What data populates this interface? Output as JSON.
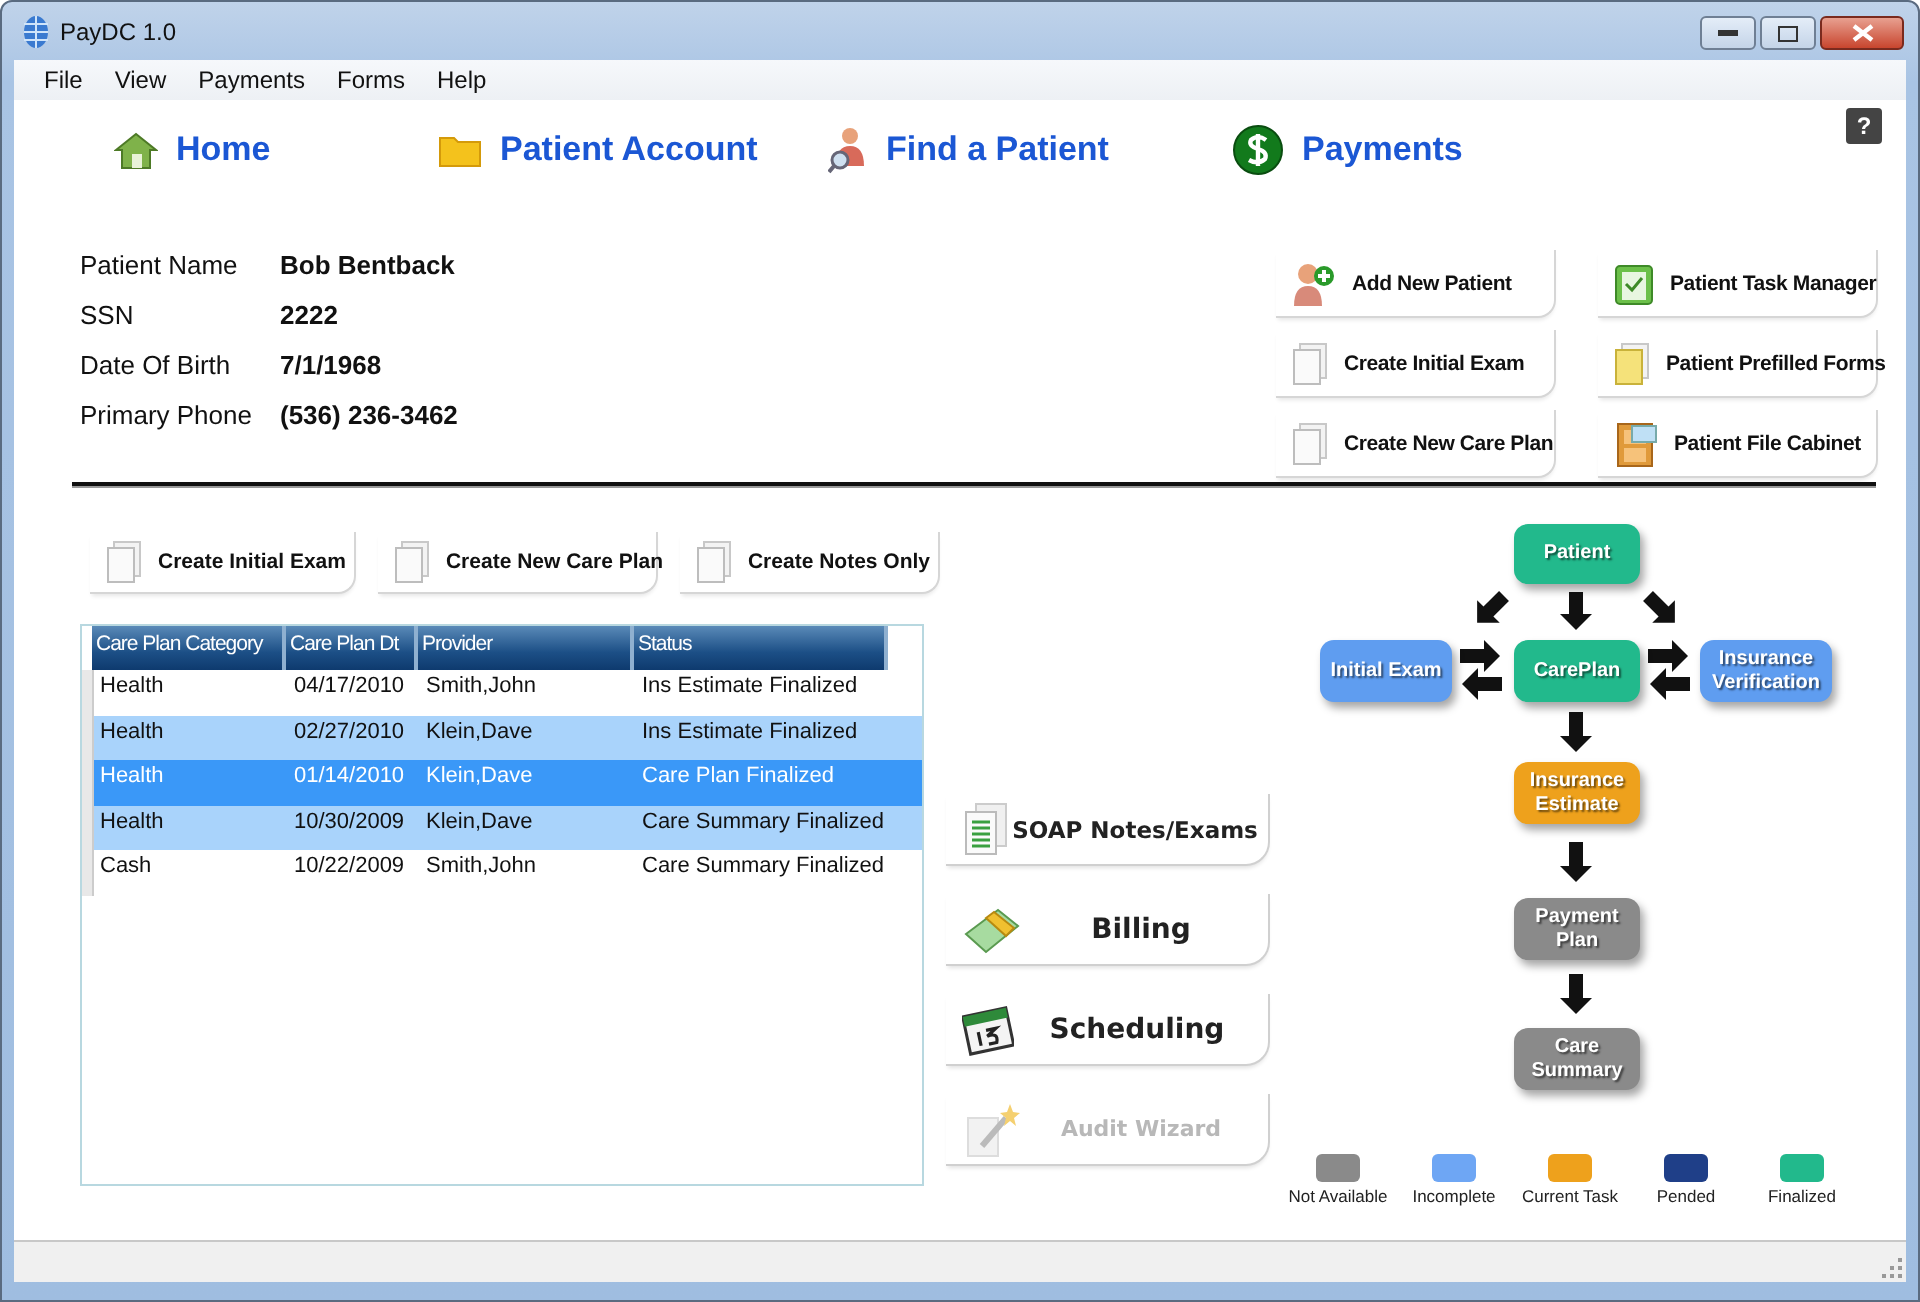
{
  "window": {
    "title": "PayDC 1.0"
  },
  "menu": [
    "File",
    "View",
    "Payments",
    "Forms",
    "Help"
  ],
  "nav": [
    {
      "label": "Home",
      "kind": "home"
    },
    {
      "label": "Patient Account",
      "kind": "folder"
    },
    {
      "label": "Find a Patient",
      "kind": "find"
    },
    {
      "label": "Payments",
      "kind": "dollar"
    }
  ],
  "help_button": "?",
  "patient": [
    {
      "label": "Patient Name",
      "value": "Bob Bentback"
    },
    {
      "label": "SSN",
      "value": "2222"
    },
    {
      "label": "Date Of Birth",
      "value": "7/1/1968"
    },
    {
      "label": "Primary Phone",
      "value": "(536) 236-3462"
    }
  ],
  "quick_actions": [
    {
      "label": "Add New Patient",
      "kind": "add-person"
    },
    {
      "label": "Patient Task Manager",
      "kind": "clipboard"
    },
    {
      "label": "Create Initial Exam",
      "kind": "document"
    },
    {
      "label": "Patient Prefilled Forms",
      "kind": "form"
    },
    {
      "label": "Create New Care Plan",
      "kind": "document"
    },
    {
      "label": "Patient File Cabinet",
      "kind": "cabinet"
    }
  ],
  "create_buttons": [
    "Create Initial Exam",
    "Create New Care Plan",
    "Create Notes Only"
  ],
  "table": {
    "columns": [
      "Care Plan Category",
      "Care Plan Dt",
      "Provider",
      "Status"
    ],
    "rows": [
      {
        "cells": [
          "Health",
          "04/17/2010",
          "Smith,John",
          "Ins Estimate Finalized"
        ],
        "selected": false,
        "focused": false
      },
      {
        "cells": [
          "Health",
          "02/27/2010",
          "Klein,Dave",
          "Ins Estimate Finalized"
        ],
        "selected": true,
        "focused": false
      },
      {
        "cells": [
          "Health",
          "01/14/2010",
          "Klein,Dave",
          "Care Plan Finalized"
        ],
        "selected": true,
        "focused": true
      },
      {
        "cells": [
          "Health",
          "10/30/2009",
          "Klein,Dave",
          "Care Summary Finalized"
        ],
        "selected": true,
        "focused": false
      },
      {
        "cells": [
          "Cash",
          "10/22/2009",
          "Smith,John",
          "Care Summary Finalized"
        ],
        "selected": false,
        "focused": false
      }
    ]
  },
  "modules": [
    {
      "label": "SOAP Notes/Exams",
      "kind": "notes",
      "disabled": false
    },
    {
      "label": "Billing",
      "kind": "money",
      "disabled": false
    },
    {
      "label": "Scheduling",
      "kind": "calendar",
      "disabled": false
    },
    {
      "label": "Audit Wizard",
      "kind": "wand",
      "disabled": true
    }
  ],
  "workflow": {
    "nodes": [
      {
        "label": "Patient",
        "color": "#22b98c"
      },
      {
        "label": "Initial Exam",
        "color": "#5f9df0"
      },
      {
        "label": "CarePlan",
        "color": "#22b98c"
      },
      {
        "label": "Insurance Verification",
        "color": "#5f9df0"
      },
      {
        "label": "Insurance Estimate",
        "color": "#eea11c"
      },
      {
        "label": "Payment Plan",
        "color": "#8a8a8a"
      },
      {
        "label": "Care Summary",
        "color": "#8a8a8a"
      }
    ],
    "legend": [
      {
        "label": "Not Available",
        "color": "#8a8a8a"
      },
      {
        "label": "Incomplete",
        "color": "#6ea6f4"
      },
      {
        "label": "Current Task",
        "color": "#eea11c"
      },
      {
        "label": "Pended",
        "color": "#1f3f88"
      },
      {
        "label": "Finalized",
        "color": "#22b98c"
      }
    ]
  }
}
